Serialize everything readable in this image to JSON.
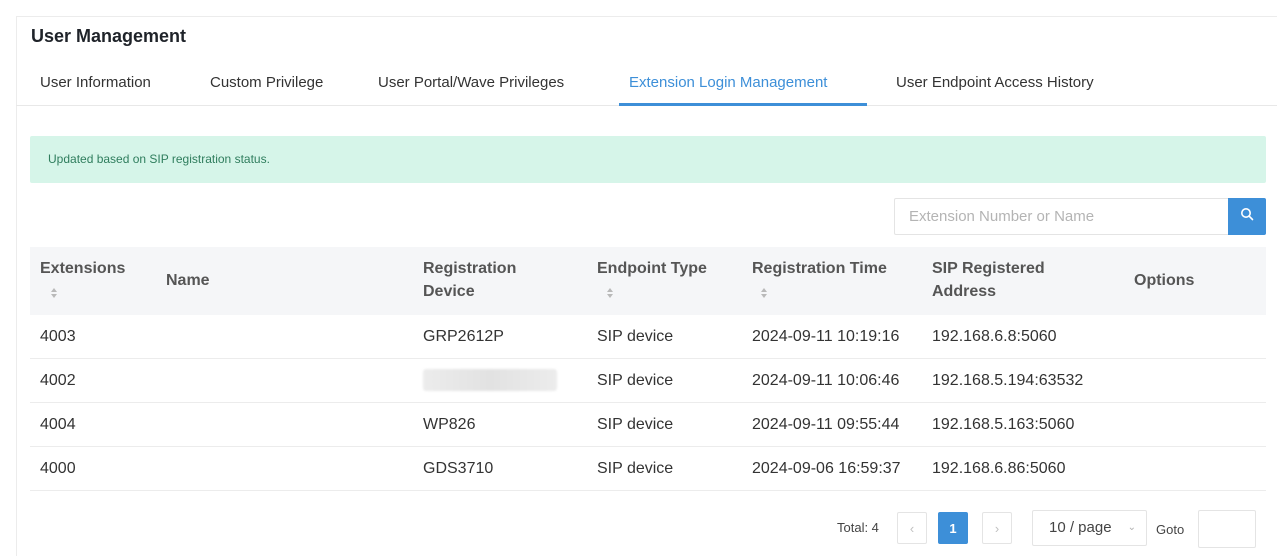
{
  "page": {
    "title": "User Management",
    "tabs": [
      {
        "label": "User Information",
        "active": false
      },
      {
        "label": "Custom Privilege",
        "active": false
      },
      {
        "label": "User Portal/Wave Privileges",
        "active": false
      },
      {
        "label": "Extension Login Management",
        "active": true
      },
      {
        "label": "User Endpoint Access History",
        "active": false
      }
    ]
  },
  "alert": {
    "text": "Updated based on SIP registration status."
  },
  "search": {
    "placeholder": "Extension Number or Name",
    "icon": "search-icon"
  },
  "table": {
    "columns": {
      "extensions": "Extensions",
      "name": "Name",
      "registration_device_line1": "Registration",
      "registration_device_line2": "Device",
      "endpoint_type": "Endpoint Type",
      "registration_time": "Registration Time",
      "sip_address_line1": "SIP Registered",
      "sip_address_line2": "Address",
      "options": "Options"
    },
    "rows": [
      {
        "extension": "4003",
        "name": "",
        "device": "GRP2612P",
        "endpoint_type": "SIP device",
        "registration_time": "2024-09-11 10:19:16",
        "sip_address": "192.168.6.8:5060",
        "device_redacted": false
      },
      {
        "extension": "4002",
        "name": "",
        "device": "",
        "endpoint_type": "SIP device",
        "registration_time": "2024-09-11 10:06:46",
        "sip_address": "192.168.5.194:63532",
        "device_redacted": true
      },
      {
        "extension": "4004",
        "name": "",
        "device": "WP826",
        "endpoint_type": "SIP device",
        "registration_time": "2024-09-11 09:55:44",
        "sip_address": "192.168.5.163:5060",
        "device_redacted": false
      },
      {
        "extension": "4000",
        "name": "",
        "device": "GDS3710",
        "endpoint_type": "SIP device",
        "registration_time": "2024-09-06 16:59:37",
        "sip_address": "192.168.6.86:5060",
        "device_redacted": false
      }
    ]
  },
  "pagination": {
    "total": "Total: 4",
    "prev": "‹",
    "current_page": "1",
    "next": "›",
    "page_size": "10 / page",
    "page_size_caret": "⌄",
    "goto_label": "Goto",
    "goto_value": ""
  },
  "colors": {
    "accent": "#3d8fd8",
    "alert_bg": "#d6f5e9",
    "alert_text": "#2f7d5d"
  }
}
